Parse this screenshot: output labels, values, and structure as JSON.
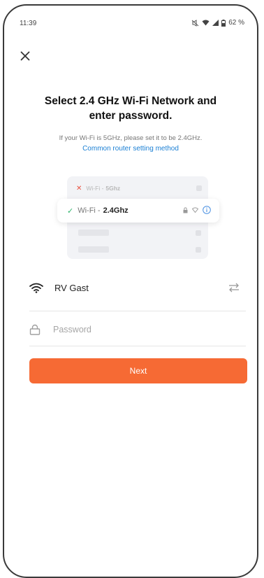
{
  "status_bar": {
    "time": "11:39",
    "battery": "62 %"
  },
  "header": {
    "close_icon": "close-icon"
  },
  "content": {
    "title_line1": "Select 2.4 GHz Wi-Fi Network and",
    "title_line2": "enter password.",
    "hint": "If your Wi-Fi is 5GHz, please set it to be 2.4GHz.",
    "router_link": "Common router setting method"
  },
  "illustration": {
    "row_5g_prefix": "Wi-Fi -",
    "row_5g_band": "5Ghz",
    "row_24g_prefix": "Wi-Fi -",
    "row_24g_band": "2.4Ghz"
  },
  "form": {
    "ssid": "RV Gast",
    "password_placeholder": "Password",
    "password_value": "",
    "next_label": "Next"
  },
  "colors": {
    "accent": "#f66a34",
    "link": "#1a7fd4",
    "check": "#2db36b",
    "cross": "#e9513f"
  }
}
